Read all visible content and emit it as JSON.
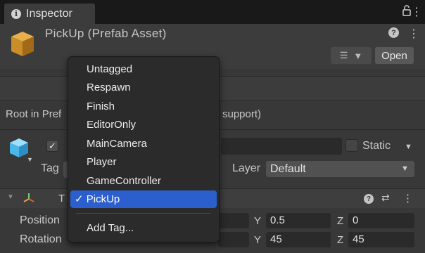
{
  "tab": {
    "label": "Inspector"
  },
  "asset": {
    "title": "PickUp (Prefab Asset)",
    "open_label": "Open"
  },
  "info_text": {
    "left": "Root in Pref",
    "right": "support)"
  },
  "object": {
    "static_label": "Static",
    "tag_label": "Tag",
    "layer_label": "Layer",
    "layer_value": "Default"
  },
  "component": {
    "title_fragment": "T"
  },
  "transform": {
    "position": {
      "label": "Position",
      "y_axis": "Y",
      "y": "0.5",
      "z_axis": "Z",
      "z": "0"
    },
    "rotation": {
      "label": "Rotation",
      "y_axis": "Y",
      "y": "45",
      "z_axis": "Z",
      "z": "45"
    }
  },
  "tag_menu": {
    "items": [
      "Untagged",
      "Respawn",
      "Finish",
      "EditorOnly",
      "MainCamera",
      "Player",
      "GameController"
    ],
    "selected": "PickUp",
    "add_tag": "Add Tag..."
  },
  "colors": {
    "selection": "#2c5fce",
    "panel": "#383838",
    "menu": "#2b2b2b"
  }
}
